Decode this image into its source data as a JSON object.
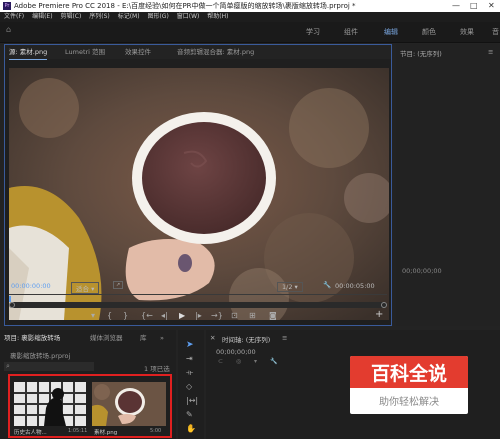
{
  "title_bar": {
    "text": "Adobe Premiere Pro CC 2018 - E:\\百度经验\\如何在PR中做一个简单瘿版的缩放转场\\裹版缩放转场.prproj *",
    "logo": "Pr",
    "minimize": "—",
    "maximize": "□",
    "close": "✕"
  },
  "menu": [
    "文件(F)",
    "编辑(E)",
    "剪辑(C)",
    "序列(S)",
    "标记(M)",
    "图形(G)",
    "窗口(W)",
    "帮助(H)"
  ],
  "workspaces": [
    "学习",
    "组件",
    "编辑",
    "颜色",
    "效果",
    "音"
  ],
  "workspace_selected": "编辑",
  "source": {
    "tabs": [
      "源: 素材.png",
      "Lumetri 范围",
      "效果控件",
      "音频剪辑混合器: 素材.png"
    ],
    "timecode_in": "00:00:00:00",
    "fit": "适合",
    "resolution": "1/2",
    "timecode_out": "00:00:05:00",
    "wrench": "🔧",
    "add": "+"
  },
  "program": {
    "title": "节目: (无序列)",
    "menu": "≡",
    "timecode": "00;00;00;00"
  },
  "project": {
    "tabs": [
      "项目: 裹影缩放转场",
      "媒体浏览器",
      "库",
      "»"
    ],
    "file": "裹影缩放转场.prproj",
    "search_icon": "magnifier",
    "count": "1 项已选",
    "items": [
      {
        "name": "历史古人物...",
        "duration": "1:05:11"
      },
      {
        "name": "素材.png",
        "duration": "5:00"
      }
    ]
  },
  "timeline": {
    "close": "✕",
    "title": "时间轴: (无序列)",
    "menu": "≡",
    "timecode": "00;00;00;00"
  },
  "watermark": {
    "main": "百科全说",
    "sub": "助你轻松解决"
  },
  "colors": {
    "accent": "#5e9ef0",
    "panel_border": "#3a5b9b",
    "highlight_box": "#e02020"
  }
}
